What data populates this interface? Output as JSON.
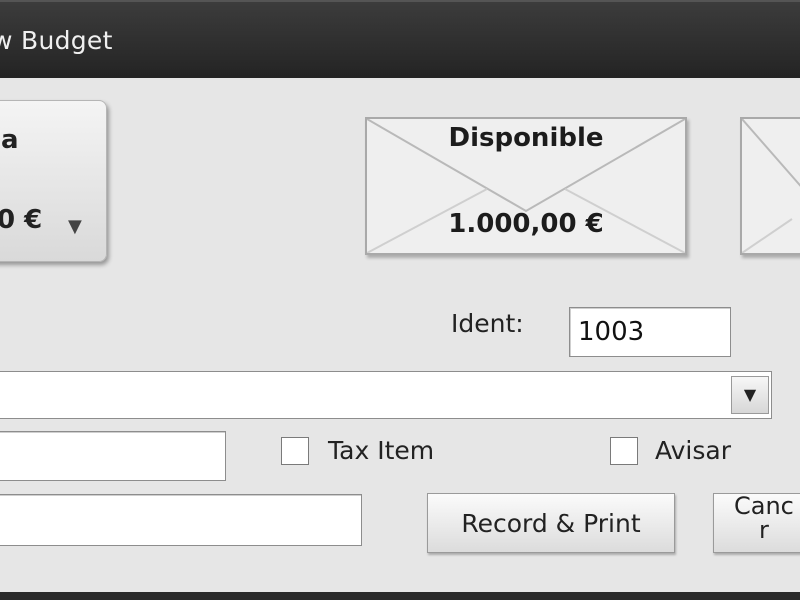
{
  "window": {
    "title": "w Budget"
  },
  "left_panel": {
    "label": "a",
    "amount": "0 €",
    "arrow": "▼"
  },
  "envelope_main": {
    "title": "Disponible",
    "amount": "1.000,00 €"
  },
  "form": {
    "ident_label": "Ident:",
    "ident_value": "1003",
    "combo_arrow": "▼",
    "tax_item_label": "Tax Item",
    "avisar_label": "Avisar",
    "field1_value": "",
    "field2_value": ""
  },
  "buttons": {
    "record_print": "Record & Print",
    "cancel": "Canc\nr"
  },
  "icons": {
    "combo": "chevron-down-icon",
    "envelope": "envelope-icon"
  }
}
